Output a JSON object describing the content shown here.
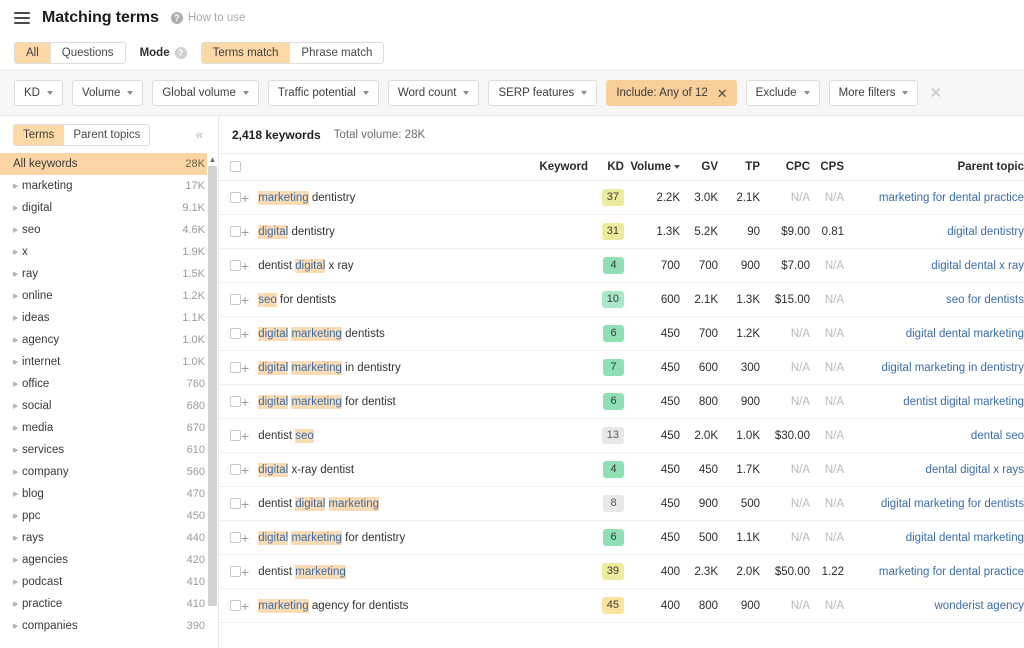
{
  "header": {
    "menu_icon": "hamburger-icon",
    "title": "Matching terms",
    "help_icon": "question-circle-icon",
    "help_label": "How to use"
  },
  "mode_row": {
    "type_tabs": [
      {
        "label": "All",
        "active": true
      },
      {
        "label": "Questions",
        "active": false
      }
    ],
    "mode_label": "Mode",
    "mode_help_icon": "question-circle-icon",
    "mode_tabs": [
      {
        "label": "Terms match",
        "active": true
      },
      {
        "label": "Phrase match",
        "active": false
      }
    ]
  },
  "filters": {
    "buttons": [
      {
        "label": "KD",
        "dropdown": true,
        "active": false
      },
      {
        "label": "Volume",
        "dropdown": true,
        "active": false
      },
      {
        "label": "Global volume",
        "dropdown": true,
        "active": false
      },
      {
        "label": "Traffic potential",
        "dropdown": true,
        "active": false
      },
      {
        "label": "Word count",
        "dropdown": true,
        "active": false
      },
      {
        "label": "SERP features",
        "dropdown": true,
        "active": false
      },
      {
        "label": "Include: Any of 12",
        "dropdown": false,
        "active": true,
        "close_icon": "close-icon"
      },
      {
        "label": "Exclude",
        "dropdown": true,
        "active": false
      },
      {
        "label": "More filters",
        "dropdown": true,
        "active": false
      }
    ],
    "clear_all_icon": "close-icon",
    "accent_color": "#f8cf9b"
  },
  "sidebar": {
    "tabs": [
      {
        "label": "Terms",
        "active": true
      },
      {
        "label": "Parent topics",
        "active": false
      }
    ],
    "collapse_icon": "chevron-double-left-icon",
    "scroll_up_icon": "chevron-up-icon",
    "root": {
      "label": "All keywords",
      "count": "28K"
    },
    "items": [
      {
        "label": "marketing",
        "count": "17K"
      },
      {
        "label": "digital",
        "count": "9.1K"
      },
      {
        "label": "seo",
        "count": "4.6K"
      },
      {
        "label": "x",
        "count": "1.9K"
      },
      {
        "label": "ray",
        "count": "1.5K"
      },
      {
        "label": "online",
        "count": "1.2K"
      },
      {
        "label": "ideas",
        "count": "1.1K"
      },
      {
        "label": "agency",
        "count": "1.0K"
      },
      {
        "label": "internet",
        "count": "1.0K"
      },
      {
        "label": "office",
        "count": "760"
      },
      {
        "label": "social",
        "count": "680"
      },
      {
        "label": "media",
        "count": "670"
      },
      {
        "label": "services",
        "count": "610"
      },
      {
        "label": "company",
        "count": "560"
      },
      {
        "label": "blog",
        "count": "470"
      },
      {
        "label": "ppc",
        "count": "450"
      },
      {
        "label": "rays",
        "count": "440"
      },
      {
        "label": "agencies",
        "count": "420"
      },
      {
        "label": "podcast",
        "count": "410"
      },
      {
        "label": "practice",
        "count": "410"
      },
      {
        "label": "companies",
        "count": "390"
      }
    ]
  },
  "main": {
    "keyword_count": "2,418 keywords",
    "total_volume": "Total volume: 28K",
    "columns": {
      "select_all": "",
      "keyword": "Keyword",
      "kd": "KD",
      "volume": "Volume",
      "gv": "GV",
      "tp": "TP",
      "cpc": "CPC",
      "cps": "CPS",
      "parent_topic": "Parent topic"
    },
    "sort_column": "Volume",
    "sort_dir": "desc",
    "rows": [
      {
        "keyword_parts": [
          {
            "t": "marketing",
            "h": true
          },
          {
            "t": " dentistry",
            "h": false
          }
        ],
        "kd": "37",
        "kd_class": "kd-yellow",
        "volume": "2.2K",
        "gv": "3.0K",
        "tp": "2.1K",
        "cpc": "N/A",
        "cps": "N/A",
        "parent_topic": "marketing for dental practice"
      },
      {
        "keyword_parts": [
          {
            "t": "digital",
            "h": true
          },
          {
            "t": " dentistry",
            "h": false
          }
        ],
        "kd": "31",
        "kd_class": "kd-yellow",
        "volume": "1.3K",
        "gv": "5.2K",
        "tp": "90",
        "cpc": "$9.00",
        "cps": "0.81",
        "parent_topic": "digital dentistry"
      },
      {
        "keyword_parts": [
          {
            "t": "dentist ",
            "h": false
          },
          {
            "t": "digital",
            "h": true
          },
          {
            "t": " x ray",
            "h": false
          }
        ],
        "kd": "4",
        "kd_class": "kd-green",
        "volume": "700",
        "gv": "700",
        "tp": "900",
        "cpc": "$7.00",
        "cps": "N/A",
        "parent_topic": "digital dental x ray"
      },
      {
        "keyword_parts": [
          {
            "t": "seo",
            "h": true
          },
          {
            "t": " for dentists",
            "h": false
          }
        ],
        "kd": "10",
        "kd_class": "kd-green-l",
        "volume": "600",
        "gv": "2.1K",
        "tp": "1.3K",
        "cpc": "$15.00",
        "cps": "N/A",
        "parent_topic": "seo for dentists"
      },
      {
        "keyword_parts": [
          {
            "t": "digital",
            "h": true
          },
          {
            "t": " ",
            "h": false
          },
          {
            "t": "marketing",
            "h": true
          },
          {
            "t": " dentists",
            "h": false
          }
        ],
        "kd": "6",
        "kd_class": "kd-green",
        "volume": "450",
        "gv": "700",
        "tp": "1.2K",
        "cpc": "N/A",
        "cps": "N/A",
        "parent_topic": "digital dental marketing"
      },
      {
        "keyword_parts": [
          {
            "t": "digital",
            "h": true
          },
          {
            "t": " ",
            "h": false
          },
          {
            "t": "marketing",
            "h": true
          },
          {
            "t": " in dentistry",
            "h": false
          }
        ],
        "kd": "7",
        "kd_class": "kd-green",
        "volume": "450",
        "gv": "600",
        "tp": "300",
        "cpc": "N/A",
        "cps": "N/A",
        "parent_topic": "digital marketing in dentistry"
      },
      {
        "keyword_parts": [
          {
            "t": "digital",
            "h": true
          },
          {
            "t": " ",
            "h": false
          },
          {
            "t": "marketing",
            "h": true
          },
          {
            "t": " for dentist",
            "h": false
          }
        ],
        "kd": "6",
        "kd_class": "kd-green",
        "volume": "450",
        "gv": "800",
        "tp": "900",
        "cpc": "N/A",
        "cps": "N/A",
        "parent_topic": "dentist digital marketing"
      },
      {
        "keyword_parts": [
          {
            "t": "dentist ",
            "h": false
          },
          {
            "t": "seo",
            "h": true
          }
        ],
        "kd": "13",
        "kd_class": "kd-grey",
        "volume": "450",
        "gv": "2.0K",
        "tp": "1.0K",
        "cpc": "$30.00",
        "cps": "N/A",
        "parent_topic": "dental seo"
      },
      {
        "keyword_parts": [
          {
            "t": "digital",
            "h": true
          },
          {
            "t": " x-ray dentist",
            "h": false
          }
        ],
        "kd": "4",
        "kd_class": "kd-green",
        "volume": "450",
        "gv": "450",
        "tp": "1.7K",
        "cpc": "N/A",
        "cps": "N/A",
        "parent_topic": "dental digital x rays"
      },
      {
        "keyword_parts": [
          {
            "t": "dentist ",
            "h": false
          },
          {
            "t": "digital",
            "h": true
          },
          {
            "t": " ",
            "h": false
          },
          {
            "t": "marketing",
            "h": true
          }
        ],
        "kd": "8",
        "kd_class": "kd-grey",
        "volume": "450",
        "gv": "900",
        "tp": "500",
        "cpc": "N/A",
        "cps": "N/A",
        "parent_topic": "digital marketing for dentists"
      },
      {
        "keyword_parts": [
          {
            "t": "digital",
            "h": true
          },
          {
            "t": " ",
            "h": false
          },
          {
            "t": "marketing",
            "h": true
          },
          {
            "t": " for dentistry",
            "h": false
          }
        ],
        "kd": "6",
        "kd_class": "kd-green",
        "volume": "450",
        "gv": "500",
        "tp": "1.1K",
        "cpc": "N/A",
        "cps": "N/A",
        "parent_topic": "digital dental marketing"
      },
      {
        "keyword_parts": [
          {
            "t": "dentist ",
            "h": false
          },
          {
            "t": "marketing",
            "h": true
          }
        ],
        "kd": "39",
        "kd_class": "kd-yellow",
        "volume": "400",
        "gv": "2.3K",
        "tp": "2.0K",
        "cpc": "$50.00",
        "cps": "1.22",
        "parent_topic": "marketing for dental practice"
      },
      {
        "keyword_parts": [
          {
            "t": "marketing",
            "h": true
          },
          {
            "t": " agency for dentists",
            "h": false
          }
        ],
        "kd": "45",
        "kd_class": "kd-orange",
        "volume": "400",
        "gv": "800",
        "tp": "900",
        "cpc": "N/A",
        "cps": "N/A",
        "parent_topic": "wonderist agency"
      }
    ]
  }
}
